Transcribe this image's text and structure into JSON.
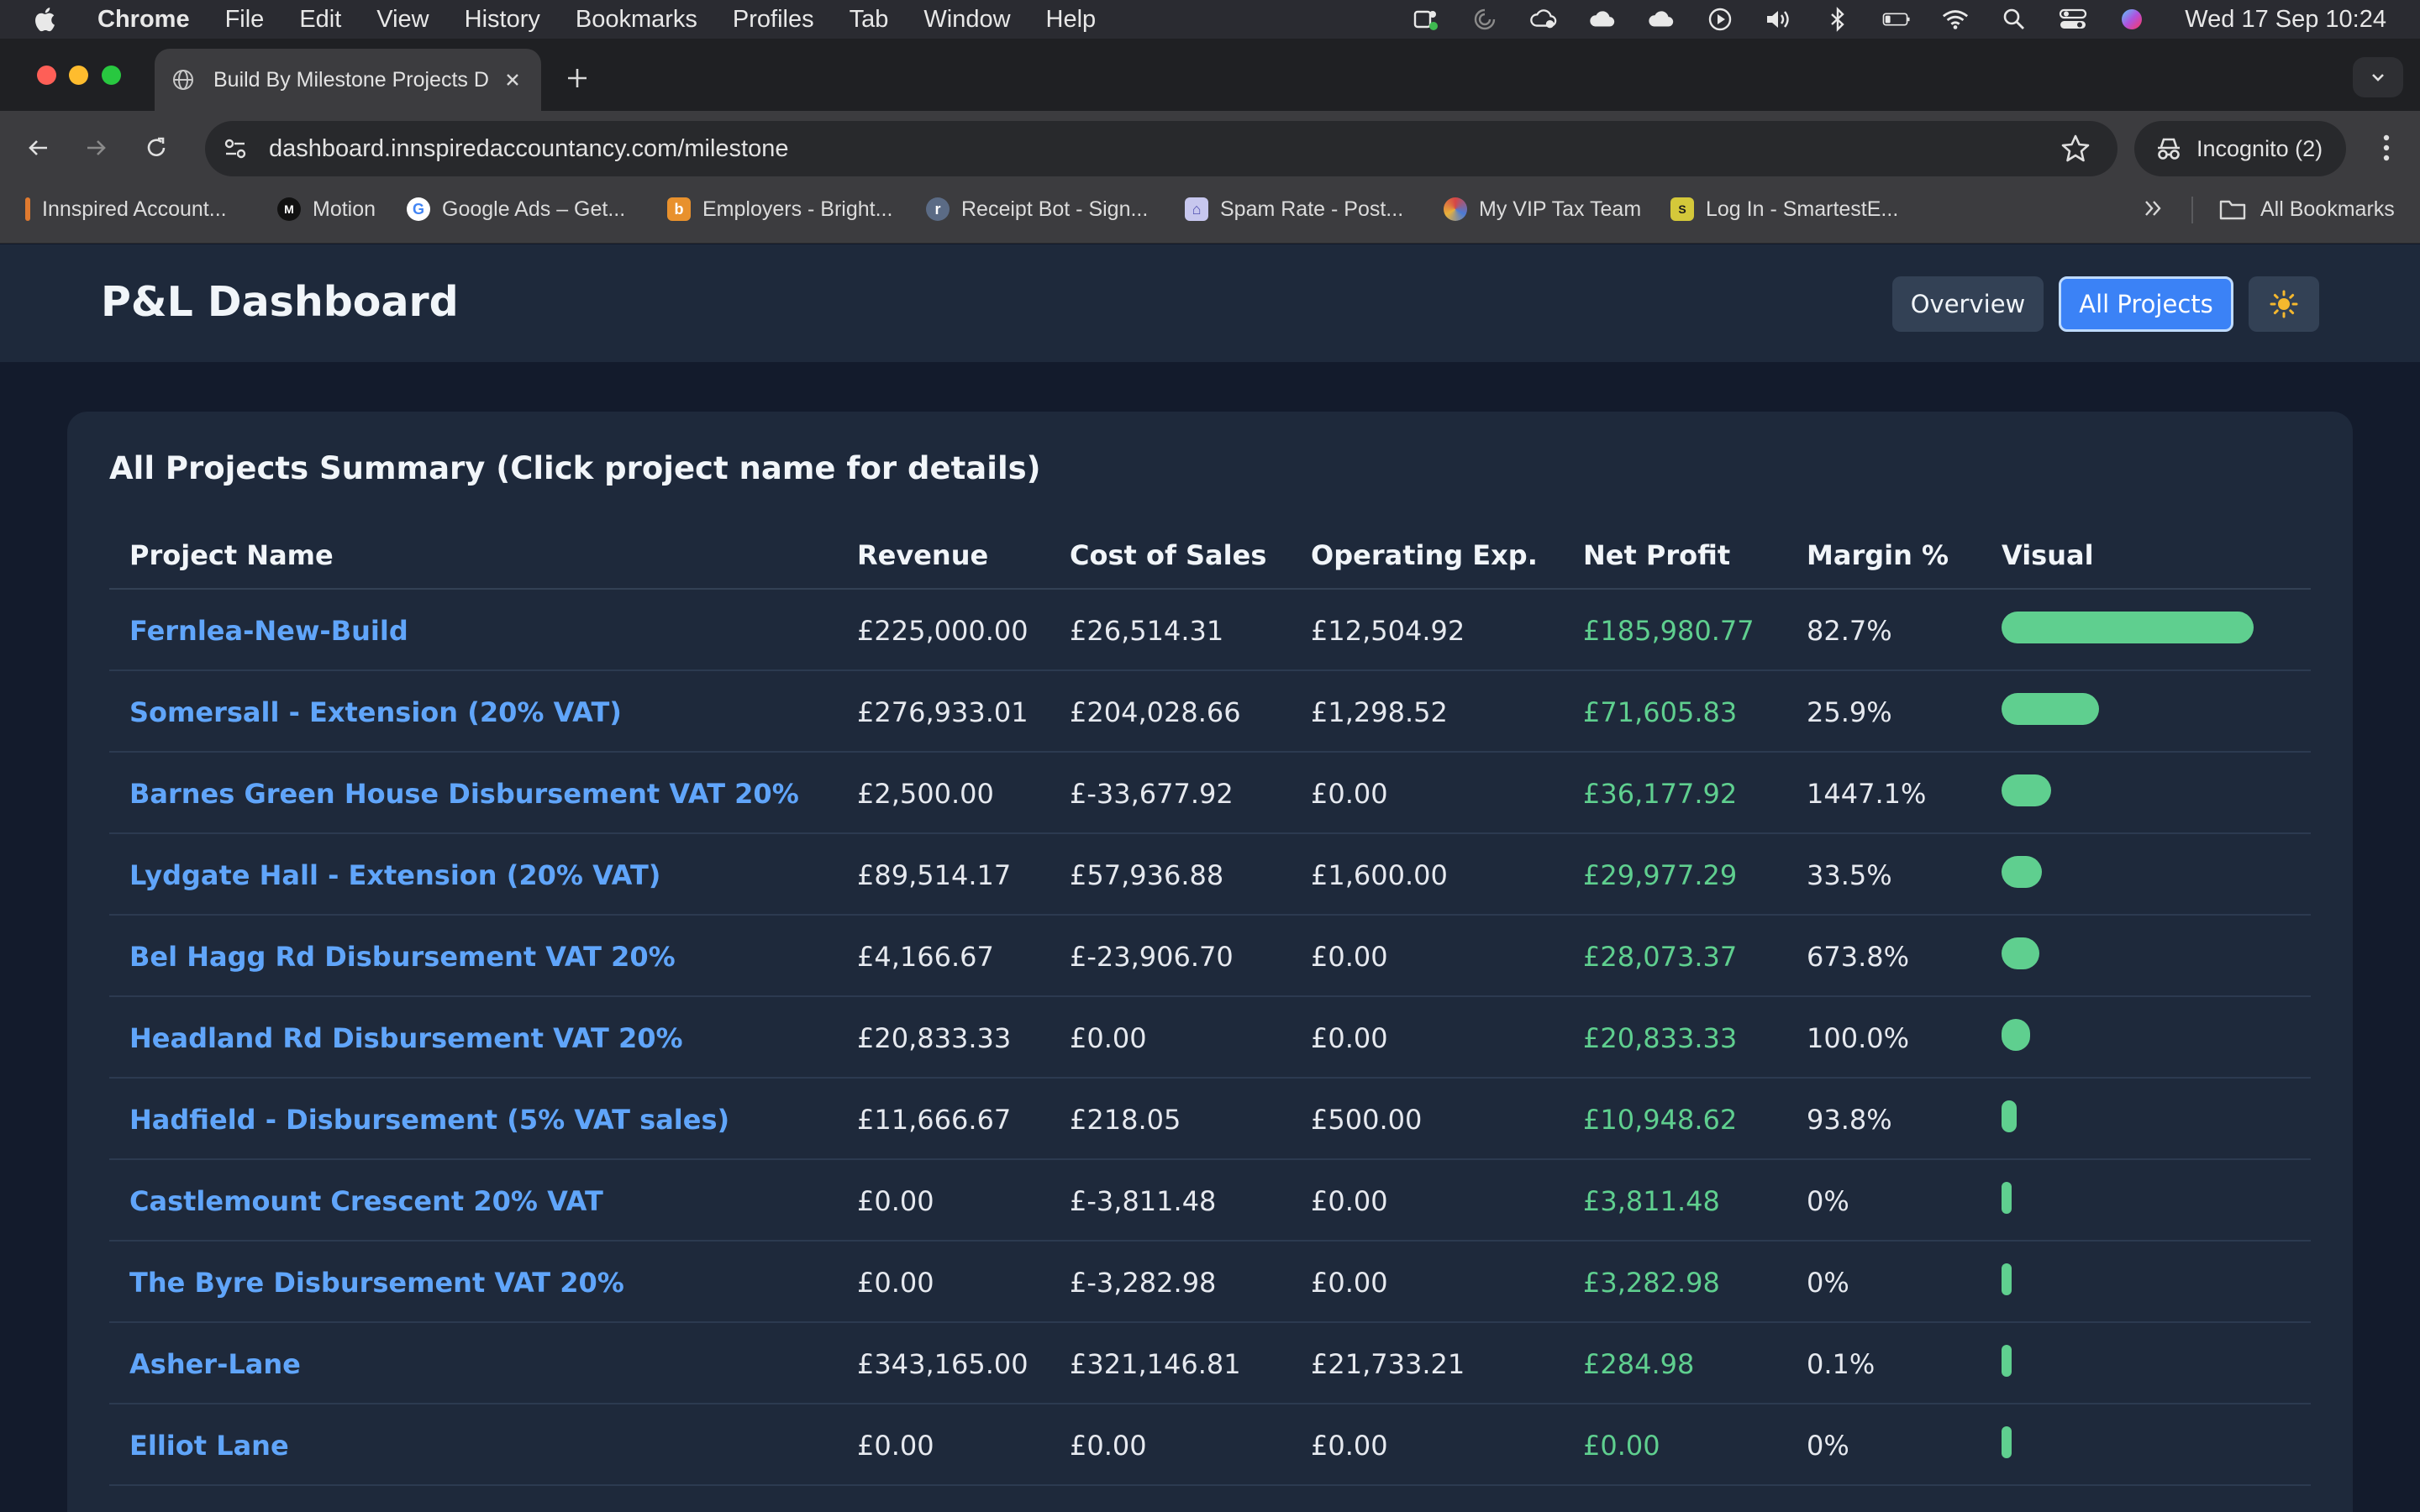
{
  "menubar": {
    "app_name": "Chrome",
    "items": [
      "File",
      "Edit",
      "View",
      "History",
      "Bookmarks",
      "Profiles",
      "Tab",
      "Window",
      "Help"
    ],
    "clock": "Wed 17 Sep  10:24"
  },
  "browser": {
    "tab_title": "Build By Milestone Projects D",
    "url": "dashboard.innspiredaccountancy.com/milestone",
    "incognito_label": "Incognito (2)",
    "bookmarks": [
      {
        "label": "Innspired Account...",
        "icon": "innspired-favicon",
        "color": "#e07a2f"
      },
      {
        "label": "Motion",
        "icon": "motion-favicon",
        "color": "#111111"
      },
      {
        "label": "Google Ads – Get...",
        "icon": "google-favicon",
        "color": "#4285f4"
      },
      {
        "label": "Employers - Bright...",
        "icon": "brighthr-favicon",
        "color": "#e8912d"
      },
      {
        "label": "Receipt Bot - Sign...",
        "icon": "receiptbot-favicon",
        "color": "#5b6b85"
      },
      {
        "label": "Spam Rate - Post...",
        "icon": "postmaster-favicon",
        "color": "#c7c7ee"
      },
      {
        "label": "My VIP Tax Team",
        "icon": "viptax-favicon",
        "color": "#d64545"
      },
      {
        "label": "Log In - SmartestE...",
        "icon": "smartest-favicon",
        "color": "#d4c83a"
      }
    ],
    "all_bookmarks_label": "All Bookmarks"
  },
  "header": {
    "title": "P&L Dashboard",
    "overview_label": "Overview",
    "all_projects_label": "All Projects",
    "theme_icon": "☀️"
  },
  "card": {
    "title": "All Projects Summary (Click project name for details)"
  },
  "table": {
    "columns": [
      "Project Name",
      "Revenue",
      "Cost of Sales",
      "Operating Exp.",
      "Net Profit",
      "Margin %",
      "Visual"
    ],
    "rows": [
      {
        "name": "Fernlea-New-Build",
        "revenue": "£225,000.00",
        "cost": "£26,514.31",
        "opex": "£12,504.92",
        "net": "£185,980.77",
        "margin": "82.7%",
        "visual": 1.0
      },
      {
        "name": "Somersall - Extension (20% VAT)",
        "revenue": "£276,933.01",
        "cost": "£204,028.66",
        "opex": "£1,298.52",
        "net": "£71,605.83",
        "margin": "25.9%",
        "visual": 0.385
      },
      {
        "name": "Barnes Green House Disbursement VAT 20%",
        "revenue": "£2,500.00",
        "cost": "£-33,677.92",
        "opex": "£0.00",
        "net": "£36,177.92",
        "margin": "1447.1%",
        "visual": 0.195
      },
      {
        "name": "Lydgate Hall - Extension (20% VAT)",
        "revenue": "£89,514.17",
        "cost": "£57,936.88",
        "opex": "£1,600.00",
        "net": "£29,977.29",
        "margin": "33.5%",
        "visual": 0.161
      },
      {
        "name": "Bel Hagg Rd Disbursement VAT 20%",
        "revenue": "£4,166.67",
        "cost": "£-23,906.70",
        "opex": "£0.00",
        "net": "£28,073.37",
        "margin": "673.8%",
        "visual": 0.151
      },
      {
        "name": "Headland Rd Disbursement VAT 20%",
        "revenue": "£20,833.33",
        "cost": "£0.00",
        "opex": "£0.00",
        "net": "£20,833.33",
        "margin": "100.0%",
        "visual": 0.112
      },
      {
        "name": "Hadfield - Disbursement (5% VAT sales)",
        "revenue": "£11,666.67",
        "cost": "£218.05",
        "opex": "£500.00",
        "net": "£10,948.62",
        "margin": "93.8%",
        "visual": 0.059
      },
      {
        "name": "Castlemount Crescent 20% VAT",
        "revenue": "£0.00",
        "cost": "£-3,811.48",
        "opex": "£0.00",
        "net": "£3,811.48",
        "margin": "0%",
        "visual": 0.02
      },
      {
        "name": "The Byre Disbursement VAT 20%",
        "revenue": "£0.00",
        "cost": "£-3,282.98",
        "opex": "£0.00",
        "net": "£3,282.98",
        "margin": "0%",
        "visual": 0.018
      },
      {
        "name": "Asher-Lane",
        "revenue": "£343,165.00",
        "cost": "£321,146.81",
        "opex": "£21,733.21",
        "net": "£284.98",
        "margin": "0.1%",
        "visual": 0.002
      },
      {
        "name": "Elliot Lane",
        "revenue": "£0.00",
        "cost": "£0.00",
        "opex": "£0.00",
        "net": "£0.00",
        "margin": "0%",
        "visual": 0.0
      }
    ]
  },
  "colors": {
    "accent": "#3b82f6",
    "link": "#60a5fa",
    "profit": "#5fcf8f",
    "bar": "#5fcf8f"
  }
}
